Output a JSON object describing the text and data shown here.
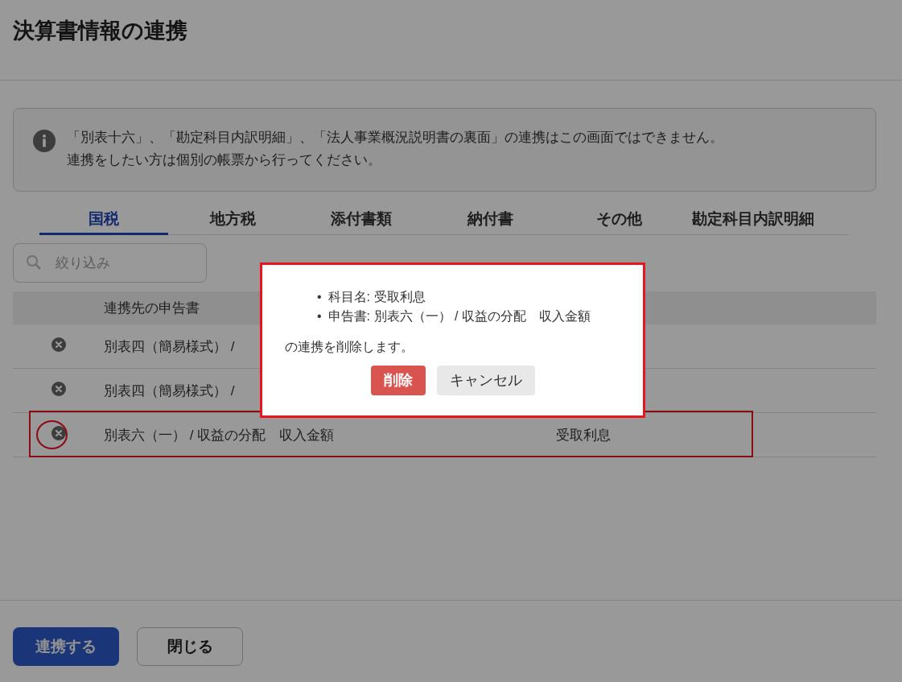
{
  "title": "決算書情報の連携",
  "notice": {
    "lines": [
      "「別表十六」、「勘定科目内訳明細」、「法人事業概況説明書の裏面」の連携はこの画面ではできません。",
      "連携をしたい方は個別の帳票から行ってください。"
    ]
  },
  "tabs": [
    {
      "label": "国税",
      "selected": true
    },
    {
      "label": "地方税",
      "selected": false
    },
    {
      "label": "添付書類",
      "selected": false
    },
    {
      "label": "納付書",
      "selected": false
    },
    {
      "label": "その他",
      "selected": false
    },
    {
      "label": "勘定科目内訳明細",
      "selected": false
    }
  ],
  "filter": {
    "placeholder": "絞り込み"
  },
  "table": {
    "columns": [
      "連携先の申告書"
    ],
    "rows": [
      {
        "cells": [
          "別表四（簡易様式） /"
        ],
        "highlighted": false
      },
      {
        "cells": [
          "別表四（簡易様式） /"
        ],
        "highlighted": false
      },
      {
        "cells": [
          "別表六（一） / 収益の分配　収入金額",
          "受取利息"
        ],
        "highlighted": true
      }
    ]
  },
  "dialog": {
    "items": [
      {
        "bullet": "•",
        "text": "科目名: 受取利息"
      },
      {
        "bullet": "•",
        "text": "申告書: 別表六（一） / 収益の分配　収入金額"
      }
    ],
    "message": "の連携を削除します。",
    "buttons": [
      {
        "label": "削除",
        "kind": "danger"
      },
      {
        "label": "キャンセル",
        "kind": "plain"
      }
    ]
  },
  "footer_buttons": [
    {
      "label": "連携する",
      "kind": "primary"
    },
    {
      "label": "閉じる",
      "kind": "plain"
    }
  ]
}
